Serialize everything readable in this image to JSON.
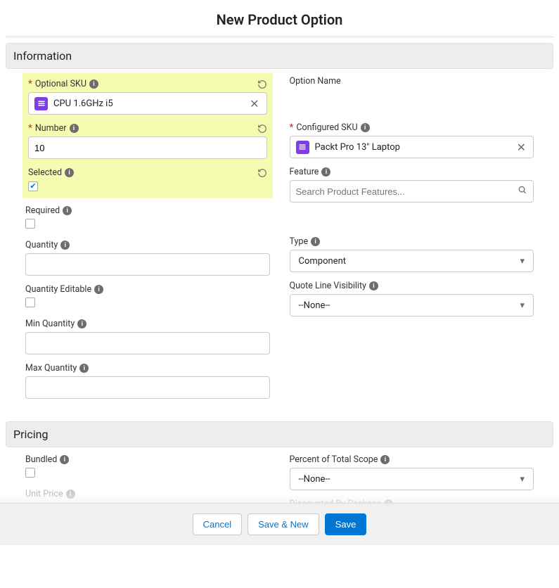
{
  "title": "New Product Option",
  "sections": {
    "information": {
      "header": "Information"
    },
    "pricing": {
      "header": "Pricing"
    }
  },
  "left": {
    "optional_sku": {
      "label": "Optional SKU",
      "value": "CPU 1.6GHz i5"
    },
    "number": {
      "label": "Number",
      "value": "10"
    },
    "selected": {
      "label": "Selected",
      "checked": true
    },
    "required": {
      "label": "Required",
      "checked": false
    },
    "quantity": {
      "label": "Quantity",
      "value": ""
    },
    "quantity_editable": {
      "label": "Quantity Editable",
      "checked": false
    },
    "min_quantity": {
      "label": "Min Quantity",
      "value": ""
    },
    "max_quantity": {
      "label": "Max Quantity",
      "value": ""
    }
  },
  "right": {
    "option_name": {
      "label": "Option Name"
    },
    "configured_sku": {
      "label": "Configured SKU",
      "value": "Packt Pro 13\" Laptop"
    },
    "feature": {
      "label": "Feature",
      "placeholder": "Search Product Features..."
    },
    "type": {
      "label": "Type",
      "value": "Component"
    },
    "quote_line_visibility": {
      "label": "Quote Line Visibility",
      "value": "--None--"
    }
  },
  "pricing": {
    "bundled": {
      "label": "Bundled",
      "checked": false
    },
    "percent_total_scope": {
      "label": "Percent of Total Scope",
      "value": "--None--"
    },
    "unit_price": {
      "label": "Unit Price"
    },
    "discounted_by_package": {
      "label": "Discounted By Package"
    }
  },
  "footer": {
    "cancel": "Cancel",
    "save_new": "Save & New",
    "save": "Save"
  }
}
